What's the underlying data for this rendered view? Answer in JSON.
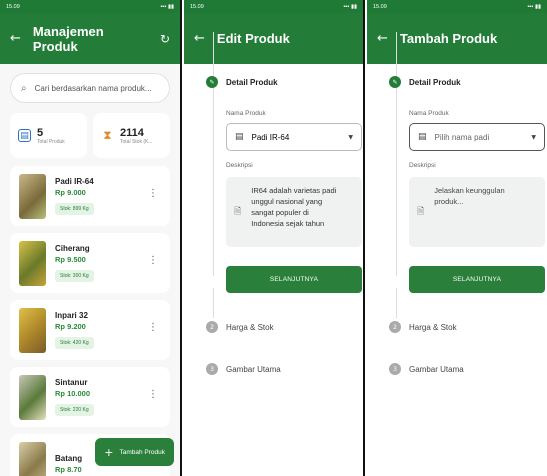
{
  "panels": [
    {
      "status_time": "15.09",
      "title": "Manajemen Produk",
      "search_placeholder": "Cari berdasarkan nama produk...",
      "stats": [
        {
          "value": "5",
          "label": "Total Produk",
          "icon": "box-icon"
        },
        {
          "value": "2114",
          "label": "Total Stok (K...",
          "icon": "hourglass-icon"
        }
      ],
      "products": [
        {
          "name": "Padi IR-64",
          "price": "Rp 9.000",
          "stock": "Stok: 899 Kg"
        },
        {
          "name": "Ciherang",
          "price": "Rp 9.500",
          "stock": "Stok: 300 Kg"
        },
        {
          "name": "Inpari 32",
          "price": "Rp 9.200",
          "stock": "Stok: 420 Kg"
        },
        {
          "name": "Sintanur",
          "price": "Rp 10.000",
          "stock": "Stok: 220 Kg"
        },
        {
          "name": "Batang",
          "price": "Rp 8.70",
          "stock": ""
        }
      ],
      "fab_label": "Tambah Produk"
    },
    {
      "status_time": "15.09",
      "title": "Edit Produk",
      "step1": "Detail Produk",
      "name_label": "Nama Produk",
      "name_value": "Padi IR-64",
      "desc_label": "Deskripsi",
      "desc_value": "IR64 adalah varietas padi unggul nasional yang sangat populer di Indonesia sejak tahun",
      "button": "SELANJUTNYA",
      "step2": "Harga & Stok",
      "step2_num": "2",
      "step3": "Gambar Utama",
      "step3_num": "3"
    },
    {
      "status_time": "15.09",
      "title": "Tambah Produk",
      "step1": "Detail Produk",
      "name_label": "Nama Produk",
      "name_placeholder": "Pilih nama padi",
      "desc_label": "Deskripsi",
      "desc_placeholder": "Jelaskan keunggulan produk...",
      "button": "SELANJUTNYA",
      "step2": "Harga & Stok",
      "step2_num": "2",
      "step3": "Gambar Utama",
      "step3_num": "3"
    }
  ],
  "colors": {
    "primary": "#237d38",
    "accent_blue": "#2d6fc4",
    "accent_orange": "#e08b2a"
  }
}
